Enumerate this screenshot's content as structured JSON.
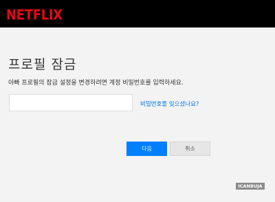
{
  "header": {
    "logo_text": "NETFLIX",
    "logo_color": "#e50914",
    "background_color": "#000000"
  },
  "main": {
    "title": "프로필 잠금",
    "description": "아빠 프로필의 잠금 설정을 변경하려면 계정 비밀번호를 입력하세요.",
    "password_field": {
      "value": "",
      "placeholder": ""
    },
    "forgot_link": "비밀번호를 잊으셨나요?",
    "next_button": "다음",
    "cancel_button": "취소",
    "accent_color": "#0080ff"
  },
  "watermark": "ICANBUJA"
}
